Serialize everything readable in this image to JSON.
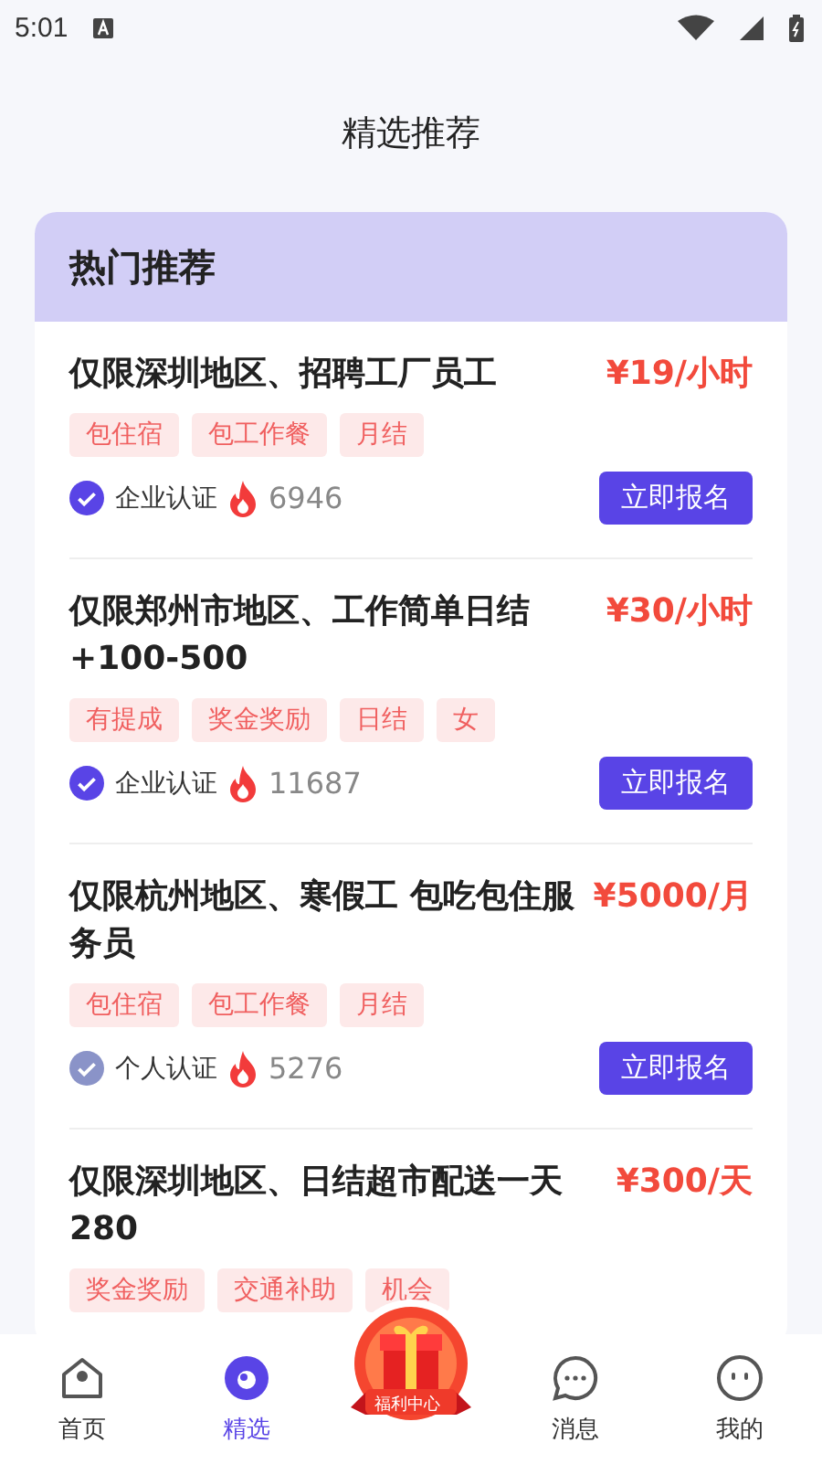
{
  "status_bar": {
    "time": "5:01"
  },
  "page_title": "精选推荐",
  "section": {
    "title": "热门推荐"
  },
  "jobs": [
    {
      "title": "仅限深圳地区、招聘工厂员工",
      "price": "¥19/小时",
      "tags": [
        "包住宿",
        "包工作餐",
        "月结"
      ],
      "kind": "enterprise",
      "verify_label": "企业认证",
      "views": "6946",
      "action": "立即报名"
    },
    {
      "title": "仅限郑州市地区、工作简单日结+100-500",
      "price": "¥30/小时",
      "tags": [
        "有提成",
        "奖金奖励",
        "日结",
        "女"
      ],
      "kind": "enterprise",
      "verify_label": "企业认证",
      "views": "11687",
      "action": "立即报名"
    },
    {
      "title": "仅限杭州地区、寒假工 包吃包住服务员",
      "price": "¥5000/月",
      "tags": [
        "包住宿",
        "包工作餐",
        "月结"
      ],
      "kind": "personal",
      "verify_label": "个人认证",
      "views": "5276",
      "action": "立即报名"
    },
    {
      "title": "仅限深圳地区、日结超市配送一天280",
      "price": "¥300/天",
      "tags": [
        "奖金奖励",
        "交通补助",
        "机会"
      ],
      "kind": "truncated"
    }
  ],
  "nav": [
    {
      "kind": "home",
      "label": "首页",
      "selected": false
    },
    {
      "kind": "featured",
      "label": "精选",
      "selected": true
    },
    {
      "kind": "badge",
      "label": "福利中心",
      "selected": false
    },
    {
      "kind": "messages",
      "label": "消息",
      "selected": false
    },
    {
      "kind": "profile",
      "label": "我的",
      "selected": false
    }
  ]
}
